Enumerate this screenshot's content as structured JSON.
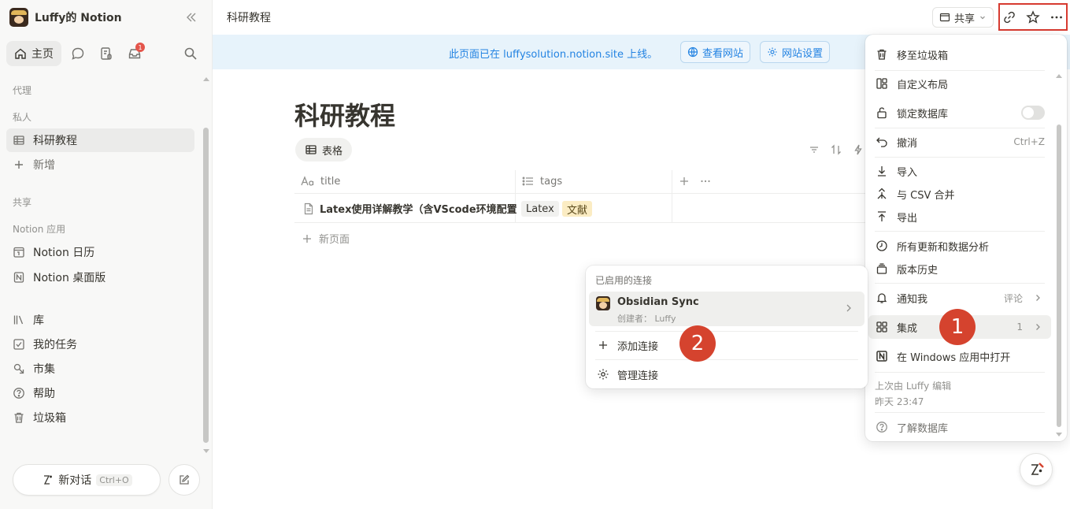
{
  "workspace": {
    "name": "Luffy的 Notion"
  },
  "sidebar": {
    "home_label": "主页",
    "inbox_badge": "1",
    "section_agent": "代理",
    "section_private": "私人",
    "private_items": [
      {
        "label": "科研教程",
        "icon": "table-icon"
      },
      {
        "label": "新增",
        "icon": "plus-icon"
      }
    ],
    "section_shared": "共享",
    "section_apps": "Notion 应用",
    "app_items": [
      {
        "label": "Notion 日历",
        "icon": "calendar-app-icon"
      },
      {
        "label": "Notion 桌面版",
        "icon": "notion-app-icon"
      }
    ],
    "bottom_items": [
      {
        "label": "库",
        "icon": "library-icon"
      },
      {
        "label": "我的任务",
        "icon": "checkbox-icon"
      },
      {
        "label": "市集",
        "icon": "marketplace-icon"
      },
      {
        "label": "帮助",
        "icon": "help-icon"
      },
      {
        "label": "垃圾箱",
        "icon": "trash-icon"
      }
    ],
    "new_chat_label": "新对话",
    "new_chat_shortcut": "Ctrl+O"
  },
  "topbar": {
    "breadcrumb": "科研教程",
    "share_label": "共享"
  },
  "banner": {
    "text": "此页面已在 luffysolution.notion.site 上线。",
    "view_site": "查看网站",
    "site_settings": "网站设置"
  },
  "page": {
    "title": "科研教程",
    "view_tab": "表格",
    "columns": [
      {
        "label": "title",
        "icon": "text-prop-icon"
      },
      {
        "label": "tags",
        "icon": "list-prop-icon"
      }
    ],
    "rows": [
      {
        "title": "Latex使用详解教学（含VScode环境配置）",
        "tags": [
          "Latex",
          "文献"
        ]
      }
    ],
    "new_page_label": "新页面"
  },
  "menu": {
    "items": [
      {
        "label": "移至垃圾箱",
        "icon": "trash-icon"
      },
      {
        "label": "自定义布局",
        "icon": "layout-icon"
      },
      {
        "label": "锁定数据库",
        "icon": "lock-icon"
      },
      {
        "label": "撤消",
        "icon": "undo-icon",
        "shortcut": "Ctrl+Z"
      },
      {
        "label": "导入",
        "icon": "import-icon"
      },
      {
        "label": "与 CSV 合并",
        "icon": "merge-icon"
      },
      {
        "label": "导出",
        "icon": "export-icon"
      },
      {
        "label": "所有更新和数据分析",
        "icon": "clock-icon"
      },
      {
        "label": "版本历史",
        "icon": "history-icon"
      },
      {
        "label": "通知我",
        "icon": "bell-icon",
        "extra": "评论"
      },
      {
        "label": "集成",
        "icon": "grid-icon",
        "extra": "1"
      },
      {
        "label": "在 Windows 应用中打开",
        "icon": "notion-icon"
      },
      {
        "label": "了解数据库",
        "icon": "help-icon"
      }
    ],
    "lock_toggle_on": false,
    "edited_by": "上次由 Luffy 编辑",
    "edited_time": "昨天 23:47"
  },
  "submenu": {
    "header": "已启用的连接",
    "connection_name": "Obsidian Sync",
    "connection_by": "创建者： Luffy",
    "add_label": "添加连接",
    "manage_label": "管理连接"
  },
  "annotations": {
    "step1": "1",
    "step2": "2"
  },
  "colors": {
    "accent_blue": "#2383e2",
    "banner_bg": "#e7f3fb",
    "highlight_red": "#d73a30",
    "step_red": "#d5432e",
    "tag_latex": "#f1f1ef",
    "tag_wenxian": "#fbecc3"
  }
}
